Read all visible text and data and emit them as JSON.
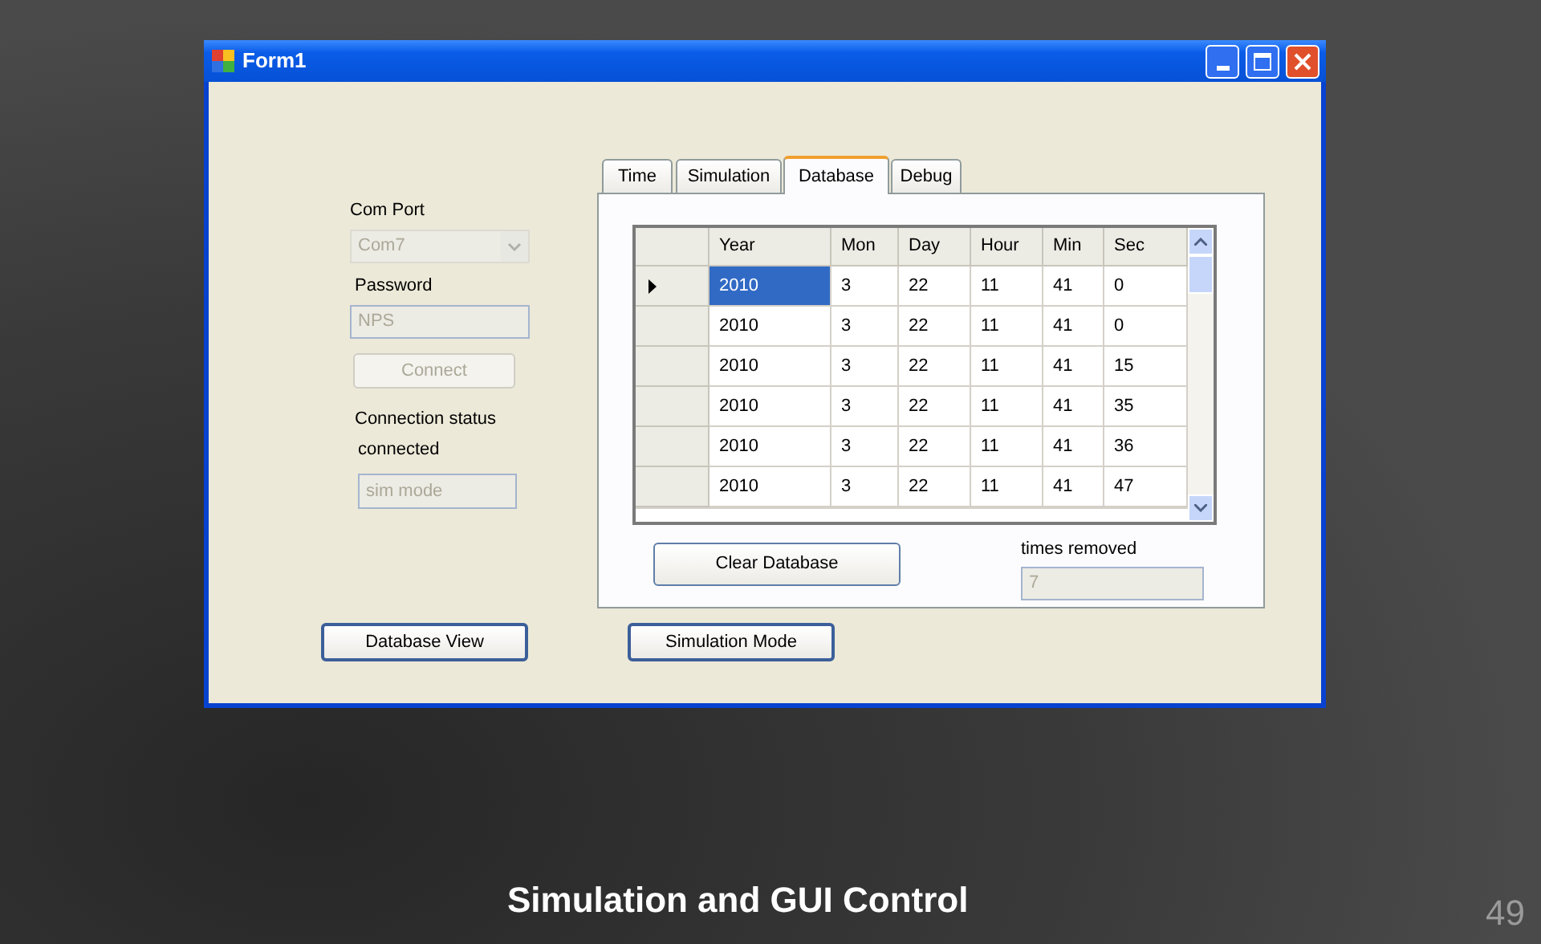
{
  "slide": {
    "title": "Simulation and GUI Control",
    "page_number": "49"
  },
  "window": {
    "title": "Form1"
  },
  "connection_panel": {
    "com_port": {
      "label": "Com Port",
      "value": "Com7",
      "disabled": true
    },
    "password": {
      "label": "Password",
      "value": "NPS",
      "disabled": true
    },
    "connect_button": {
      "label": "Connect",
      "disabled": true
    },
    "status": {
      "label": "Connection status",
      "value": "connected"
    },
    "mode_field": {
      "value": "sim mode",
      "disabled": true
    }
  },
  "tabs": [
    {
      "label": "Time",
      "selected": false
    },
    {
      "label": "Simulation",
      "selected": false
    },
    {
      "label": "Database",
      "selected": true
    },
    {
      "label": "Debug",
      "selected": false
    }
  ],
  "table": {
    "columns": [
      "Year",
      "Mon",
      "Day",
      "Hour",
      "Min",
      "Sec"
    ],
    "rows": [
      {
        "cells": [
          "2010",
          "3",
          "22",
          "11",
          "41",
          "0"
        ],
        "selected": true
      },
      {
        "cells": [
          "2010",
          "3",
          "22",
          "11",
          "41",
          "0"
        ],
        "selected": false
      },
      {
        "cells": [
          "2010",
          "3",
          "22",
          "11",
          "41",
          "15"
        ],
        "selected": false
      },
      {
        "cells": [
          "2010",
          "3",
          "22",
          "11",
          "41",
          "35"
        ],
        "selected": false
      },
      {
        "cells": [
          "2010",
          "3",
          "22",
          "11",
          "41",
          "36"
        ],
        "selected": false
      },
      {
        "cells": [
          "2010",
          "3",
          "22",
          "11",
          "41",
          "47"
        ],
        "selected": false
      }
    ]
  },
  "clear_button": "Clear Database",
  "times_removed": {
    "label": "times removed",
    "value": "7",
    "disabled": true
  },
  "bottom_buttons": [
    "Database View",
    "Simulation Mode"
  ]
}
